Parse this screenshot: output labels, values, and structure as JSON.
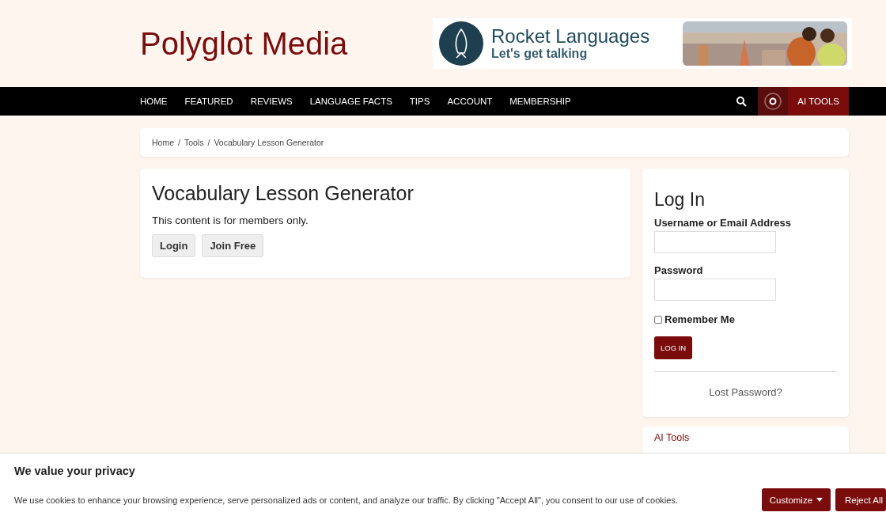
{
  "site_title": "Polyglot Media",
  "ad": {
    "brand": "Rocket Languages",
    "tagline": "Let's get talking"
  },
  "nav": {
    "items": [
      {
        "label": "HOME"
      },
      {
        "label": "FEATURED"
      },
      {
        "label": "REVIEWS"
      },
      {
        "label": "LANGUAGE FACTS"
      },
      {
        "label": "TIPS"
      },
      {
        "label": "ACCOUNT"
      },
      {
        "label": "MEMBERSHIP"
      }
    ],
    "cta": "AI TOOLS"
  },
  "breadcrumb": [
    {
      "label": "Home"
    },
    {
      "label": "Tools"
    },
    {
      "label": "Vocabulary Lesson Generator"
    }
  ],
  "breadcrumb_separator": "/",
  "main": {
    "title": "Vocabulary Lesson Generator",
    "message": "This content is for members only.",
    "buttons": [
      "Login",
      "Join Free"
    ]
  },
  "login": {
    "title": "Log In",
    "username_label": "Username or Email Address",
    "password_label": "Password",
    "remember": {
      "label": "Remember Me",
      "checked": false
    },
    "submit": "LOG IN",
    "lost": "Lost Password?"
  },
  "sidebar_card": {
    "title": "AI Tools"
  },
  "cookie": {
    "title": "We value your privacy",
    "text": "We use cookies to enhance your browsing experience, serve personalized ads or content, and analyze our traffic. By clicking \"Accept All\", you consent to our use of cookies.",
    "buttons": [
      {
        "label": "Customize",
        "kind": "dropdown"
      },
      {
        "label": "Reject All",
        "kind": "plain"
      }
    ]
  }
}
